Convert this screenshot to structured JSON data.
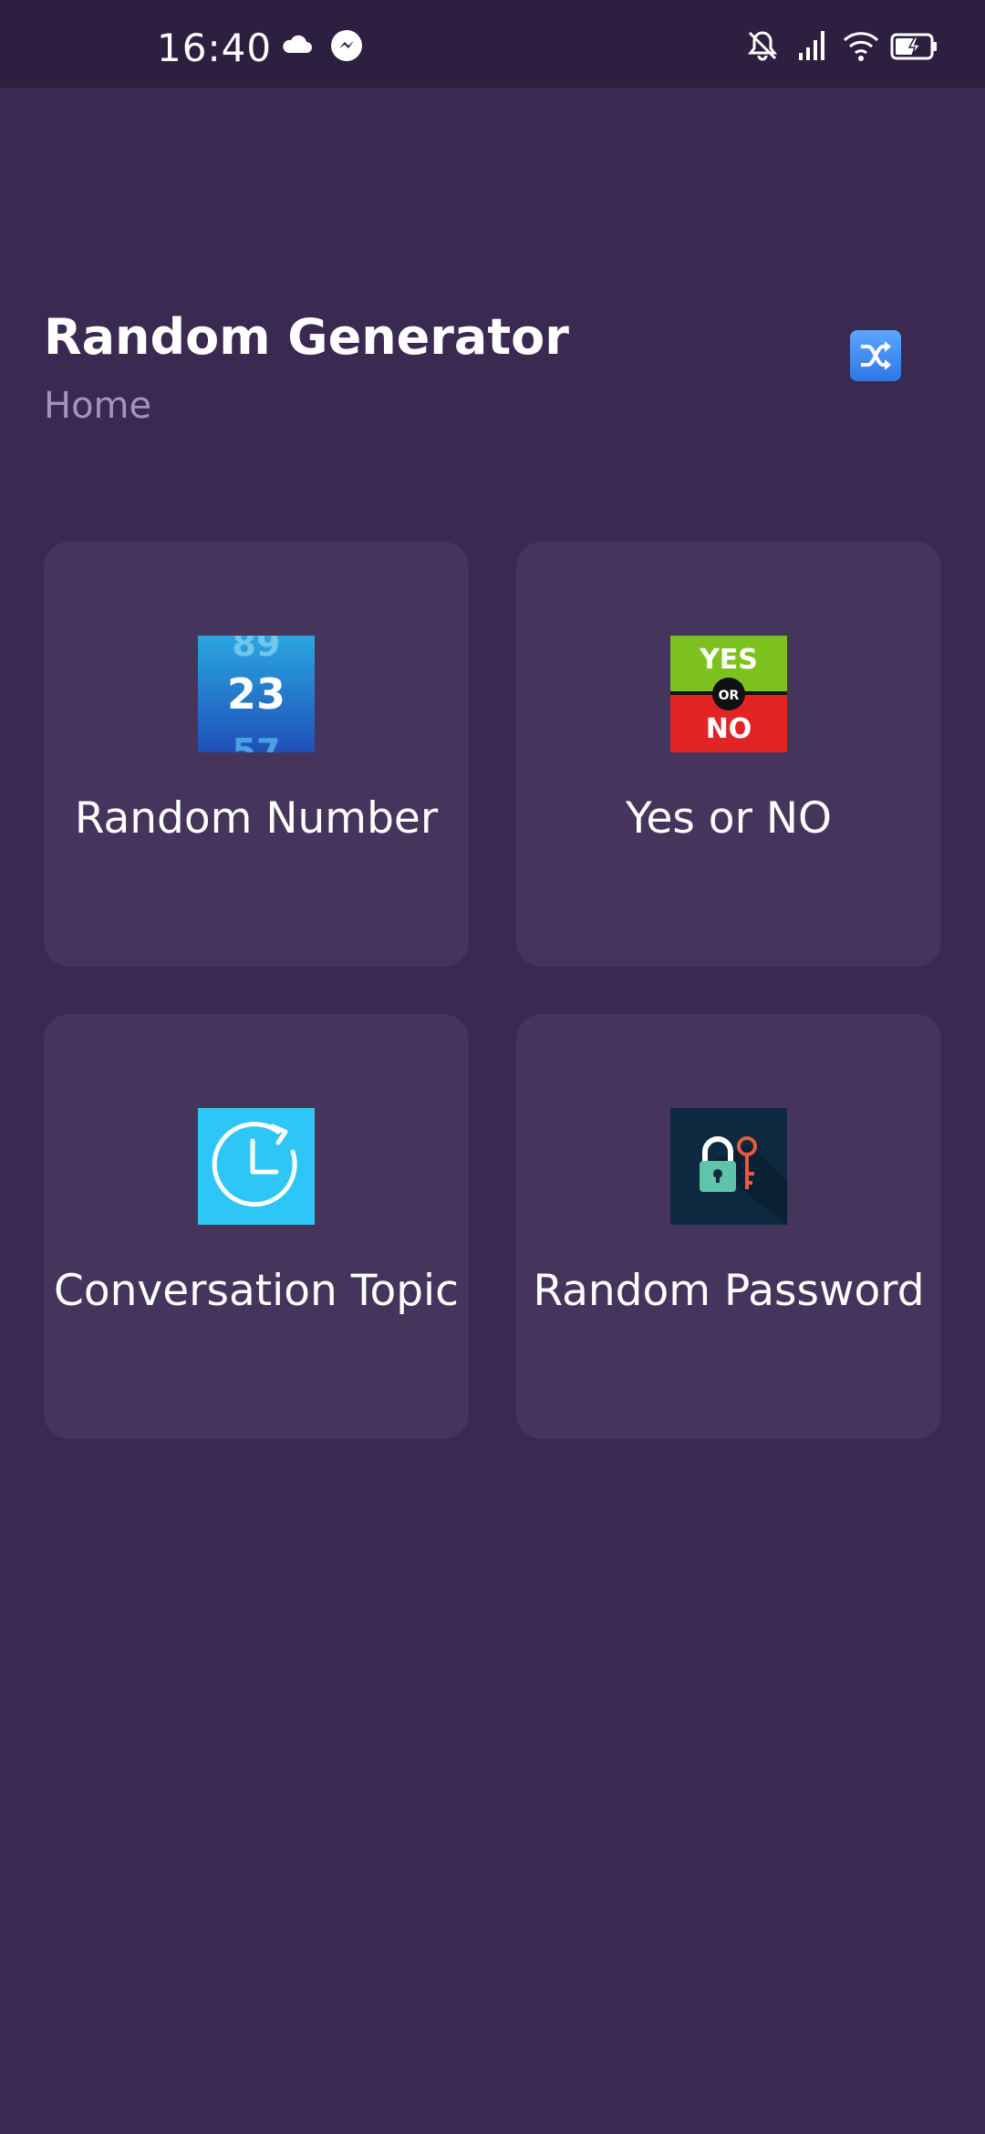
{
  "status_bar": {
    "time": "16:40",
    "icons": [
      "cloud-icon",
      "messenger-icon",
      "bell-off-icon",
      "signal-icon",
      "wifi-icon",
      "battery-charging-icon"
    ]
  },
  "header": {
    "title": "Random Generator",
    "subtitle": "Home",
    "action_icon": "shuffle-icon"
  },
  "cards": [
    {
      "label": "Random Number",
      "icon": "random-number-icon",
      "icon_numbers": [
        "89",
        "23",
        "57"
      ]
    },
    {
      "label": "Yes or NO",
      "icon": "yes-or-no-icon",
      "icon_text": [
        "YES",
        "OR",
        "NO"
      ]
    },
    {
      "label": "Conversation Topic",
      "icon": "clock-icon"
    },
    {
      "label": "Random Password",
      "icon": "lock-key-icon"
    }
  ],
  "colors": {
    "background": "#3a2950",
    "status_bar": "#2d1f40",
    "card": "#45355c",
    "subtitle": "#a593bb"
  }
}
